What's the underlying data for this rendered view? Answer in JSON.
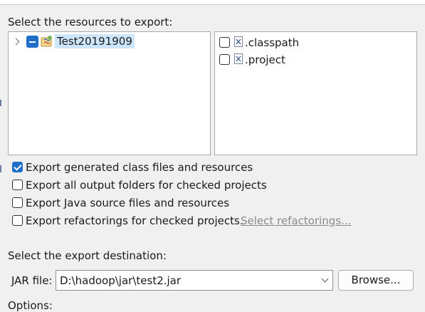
{
  "resources": {
    "heading": "Select the resources to export:",
    "project_name": "Test20191909",
    "files": [
      ".classpath",
      ".project"
    ]
  },
  "options": [
    {
      "label": "Export generated class files and resources",
      "checked": true
    },
    {
      "label": "Export all output folders for checked projects",
      "checked": false
    },
    {
      "label": "Export Java source files and resources",
      "checked": false
    },
    {
      "label": "Export refactorings for checked projects.",
      "checked": false
    }
  ],
  "select_refactorings_link": "Select refactorings...",
  "destination": {
    "heading": "Select the export destination:",
    "jar_file_label": "JAR file:",
    "jar_file_value": "D:\\hadoop\\jar\\test2.jar",
    "browse_label": "Browse..."
  },
  "options_heading": "Options:",
  "colors": {
    "accent": "#1f6fc9",
    "selection": "#cde6fb",
    "link": "#8a8a8a"
  }
}
